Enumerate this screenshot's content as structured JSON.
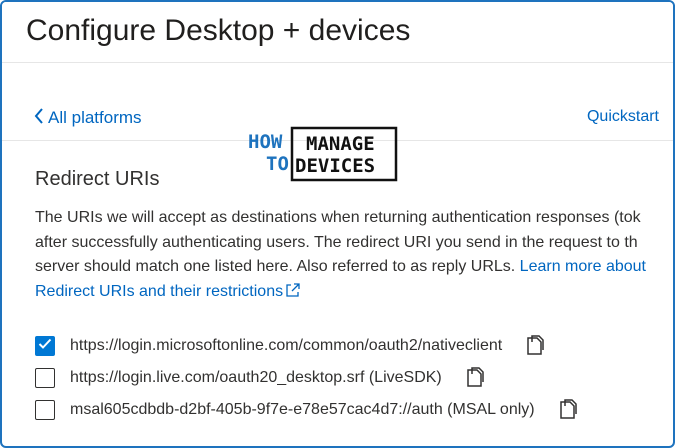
{
  "header": {
    "title": "Configure Desktop + devices"
  },
  "nav": {
    "back_label": "All platforms",
    "quickstart_label": "Quickstart"
  },
  "watermark": {
    "line1_left": "HOW",
    "line1_right": "MANAGE",
    "line2_left": "TO",
    "line2_right": "DEVICES"
  },
  "section": {
    "title": "Redirect URIs",
    "description_line1": "The URIs we will accept as destinations when returning authentication responses (tok",
    "description_line2": "after successfully authenticating users. The redirect URI you send in the request to th",
    "description_line3_text": "server should match one listed here. Also referred to as reply URLs. ",
    "learn_more_link": "Learn more about",
    "restrictions_link": "Redirect URIs and their restrictions"
  },
  "uris": [
    {
      "url": "https://login.microsoftonline.com/common/oauth2/nativeclient",
      "checked": true
    },
    {
      "url": "https://login.live.com/oauth20_desktop.srf (LiveSDK)",
      "checked": false
    },
    {
      "url": "msal605cdbdb-d2bf-405b-9f7e-e78e57cac4d7://auth (MSAL only)",
      "checked": false
    }
  ],
  "colors": {
    "accent": "#0078d4",
    "link": "#0066c0",
    "frame": "#1e73be"
  },
  "icons": {
    "back": "chevron-left-icon",
    "copy": "copy-icon",
    "external": "external-link-icon",
    "check": "checkmark-icon"
  }
}
